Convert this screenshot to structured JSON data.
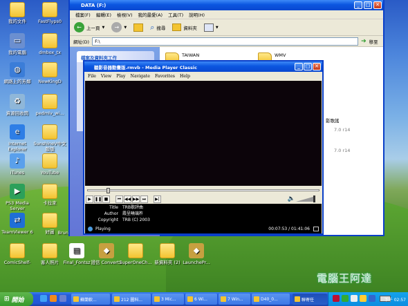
{
  "desktop": {
    "icons": [
      {
        "label": "我的文件",
        "type": "folder"
      },
      {
        "label": "FastFlyps0",
        "type": "folder"
      },
      {
        "label": "我的電腦",
        "type": "computer"
      },
      {
        "label": "dmbox_tx",
        "type": "folder"
      },
      {
        "label": "網路上的芳鄰",
        "type": "network"
      },
      {
        "label": "NewKingD",
        "type": "folder"
      },
      {
        "label": "資源回收筒",
        "type": "recycle"
      },
      {
        "label": "pedmlv_wi...",
        "type": "folder"
      },
      {
        "label": "Internet Explorer",
        "type": "ie"
      },
      {
        "label": "SunshineV中文版版",
        "type": "folder"
      },
      {
        "label": "iTunes",
        "type": "itunes"
      },
      {
        "label": "YouTube",
        "type": "folder"
      },
      {
        "label": "PS3 Media Server",
        "type": "ps3"
      },
      {
        "label": "卡拉來",
        "type": "folder"
      },
      {
        "label": "TeamViewer 6",
        "type": "teamviewer"
      },
      {
        "label": "好圖",
        "type": "folder"
      },
      {
        "label": "ComicShelf-",
        "type": "folder"
      },
      {
        "label": "客人照片",
        "type": "folder"
      },
      {
        "label": "Final_Fontsz",
        "type": "doc"
      },
      {
        "label": "證信 Convert2",
        "type": "app"
      },
      {
        "label": "SuperOneCh...",
        "type": "folder"
      },
      {
        "label": "新資料夾 (2)",
        "type": "folder"
      },
      {
        "label": "LaunchePr...",
        "type": "app"
      }
    ],
    "partial_labels": [
      "Bruno Mo..."
    ],
    "watermark": "電腦王阿達"
  },
  "explorer": {
    "title": "DATA (F:)",
    "menu": [
      "檔案(F)",
      "編輯(E)",
      "檢視(V)",
      "我的最愛(A)",
      "工具(T)",
      "說明(H)"
    ],
    "toolbar": {
      "back": "上一頁",
      "search": "搜尋",
      "folders": "資料夾"
    },
    "address": {
      "label": "網址(D)",
      "value": "F:\\",
      "go": "移至"
    },
    "task_title": "檔案及資料夾工作",
    "folders": [
      "TAIWAN",
      "WMV"
    ],
    "right_text": [
      "影歌謠",
      "7.0 r14",
      "7.0 r14"
    ]
  },
  "mpc": {
    "title": "聽影音器動畫版.rmvb - Media Player Classic",
    "menu": [
      "File",
      "View",
      "Play",
      "Navigate",
      "Favorites",
      "Help"
    ],
    "info": [
      {
        "key": "Title",
        "value": "TRB歌評曲"
      },
      {
        "key": "Author",
        "value": "霞呈曉璃杵"
      },
      {
        "key": "Copyright",
        "value": "TRB (C) 2003"
      }
    ],
    "status": "Playing",
    "time": "00:07:53 / 01:41:06",
    "seek_fraction": 0.083
  },
  "taskbar": {
    "start": "開始",
    "buttons": [
      "蘇蘭軟...",
      "212 圖科...",
      "3 Mic...",
      "6 Wi...",
      "7 Win...",
      "D40_0...",
      "聯寄任"
    ],
    "clock": "下午 02:57"
  }
}
